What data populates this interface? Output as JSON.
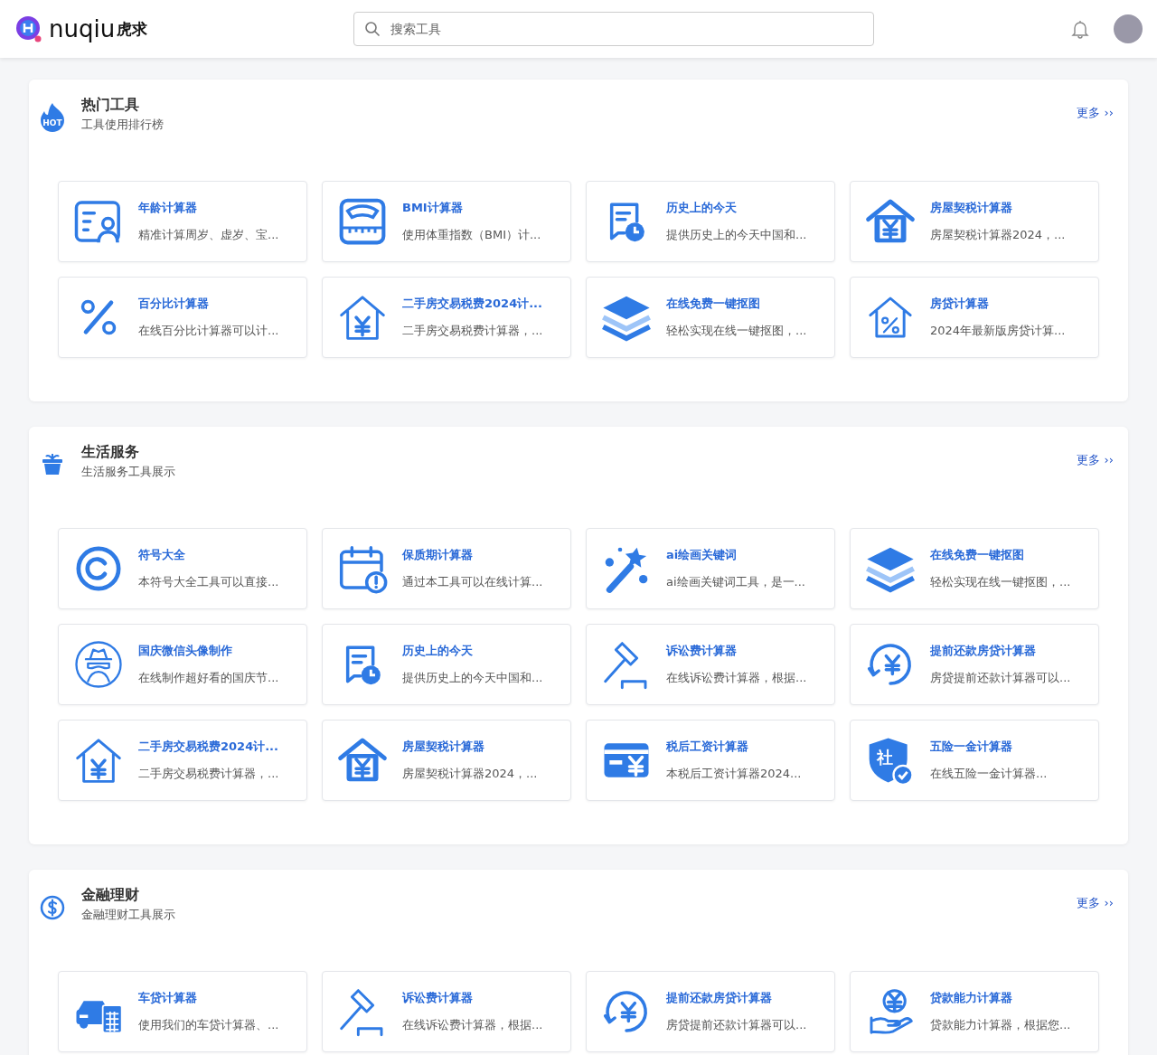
{
  "header": {
    "logo_text": "nuqiu",
    "logo_cn": "虎求",
    "search": {
      "placeholder": "搜索工具"
    }
  },
  "sections": [
    {
      "kind": "hot",
      "icon_text": "HOT",
      "title": "热门工具",
      "subtitle": "工具使用排行榜",
      "more": "更多 ››",
      "tools": [
        {
          "kind": "id-card",
          "name": "年龄计算器",
          "desc": "精准计算周岁、虚岁、宝..."
        },
        {
          "kind": "scale",
          "name": "BMI计算器",
          "desc": "使用体重指数（BMI）计..."
        },
        {
          "kind": "doc-clock",
          "name": "历史上的今天",
          "desc": "提供历史上的今天中国和..."
        },
        {
          "kind": "house-yen",
          "name": "房屋契税计算器",
          "desc": "房屋契税计算器2024，..."
        },
        {
          "kind": "percent",
          "name": "百分比计算器",
          "desc": "在线百分比计算器可以计..."
        },
        {
          "kind": "house-yen-outline",
          "name": "二手房交易税费2024计...",
          "desc": "二手房交易税费计算器，..."
        },
        {
          "kind": "layers",
          "name": "在线免费一键抠图",
          "desc": "轻松实现在线一键抠图，..."
        },
        {
          "kind": "house-percent",
          "name": "房贷计算器",
          "desc": "2024年最新版房贷计算..."
        }
      ]
    },
    {
      "kind": "gift",
      "title": "生活服务",
      "subtitle": "生活服务工具展示",
      "more": "更多 ››",
      "tools": [
        {
          "kind": "ring",
          "name": "符号大全",
          "desc": "本符号大全工具可以直接..."
        },
        {
          "kind": "calendar-alert",
          "name": "保质期计算器",
          "desc": "通过本工具可以在线计算..."
        },
        {
          "kind": "wand",
          "name": "ai绘画关键词",
          "desc": "ai绘画关键词工具，是一..."
        },
        {
          "kind": "layers",
          "name": "在线免费一键抠图",
          "desc": "轻松实现在线一键抠图，..."
        },
        {
          "kind": "spy",
          "name": "国庆微信头像制作",
          "desc": "在线制作超好看的国庆节..."
        },
        {
          "kind": "doc-clock",
          "name": "历史上的今天",
          "desc": "提供历史上的今天中国和..."
        },
        {
          "kind": "gavel",
          "name": "诉讼费计算器",
          "desc": "在线诉讼费计算器，根据..."
        },
        {
          "kind": "yen-cycle",
          "name": "提前还款房贷计算器",
          "desc": "房贷提前还款计算器可以..."
        },
        {
          "kind": "house-yen-outline",
          "name": "二手房交易税费2024计...",
          "desc": "二手房交易税费计算器，..."
        },
        {
          "kind": "house-yen",
          "name": "房屋契税计算器",
          "desc": "房屋契税计算器2024，..."
        },
        {
          "kind": "card-yen",
          "name": "税后工资计算器",
          "desc": "本税后工资计算器2024..."
        },
        {
          "kind": "shield",
          "icon_text": "社",
          "name": "五险一金计算器",
          "desc": "在线五险一金计算器..."
        }
      ]
    },
    {
      "kind": "dollar",
      "title": "金融理财",
      "subtitle": "金融理财工具展示",
      "more": "更多 ››",
      "tools": [
        {
          "kind": "car",
          "name": "车贷计算器",
          "desc": "使用我们的车贷计算器、..."
        },
        {
          "kind": "gavel",
          "name": "诉讼费计算器",
          "desc": "在线诉讼费计算器，根据..."
        },
        {
          "kind": "yen-cycle",
          "name": "提前还款房贷计算器",
          "desc": "房贷提前还款计算器可以..."
        },
        {
          "kind": "hand-coin",
          "name": "贷款能力计算器",
          "desc": "贷款能力计算器，根据您..."
        }
      ]
    }
  ]
}
